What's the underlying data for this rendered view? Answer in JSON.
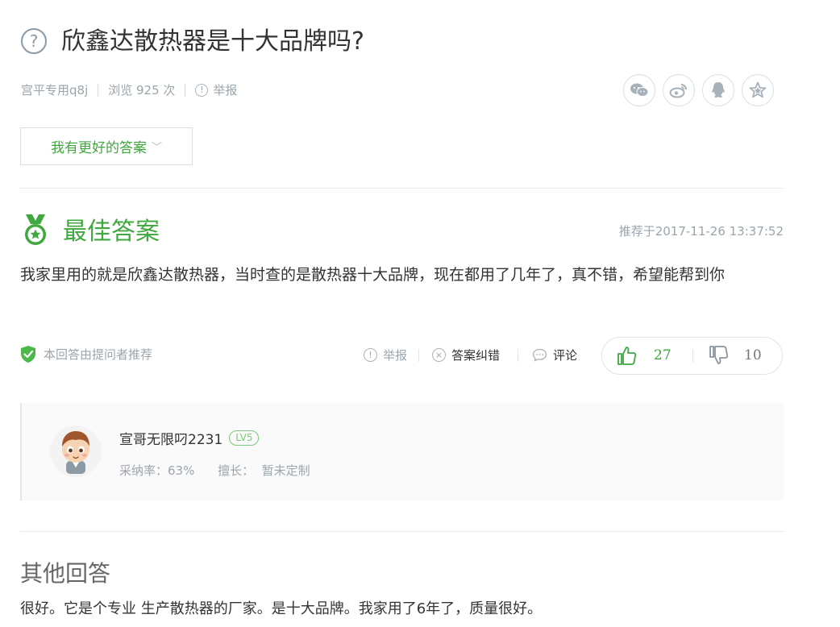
{
  "question": {
    "title": "欣鑫达散热器是十大品牌吗?",
    "asker": "宫平专用q8j",
    "views": "浏览 925 次",
    "report": "举报"
  },
  "share_icons": [
    "wechat-icon",
    "weibo-icon",
    "qq-icon",
    "star-icon"
  ],
  "better_answer_button": "我有更好的答案",
  "best_answer": {
    "heading": "最佳答案",
    "recommended_time": "推荐于2017-11-26 13:37:52",
    "text": "我家里用的就是欣鑫达散热器，当时查的是散热器十大品牌，现在都用了几年了，真不错，希望能帮到你",
    "asker_recommended": "本回答由提问者推荐",
    "actions": {
      "report": "举报",
      "correct": "答案纠错",
      "comment": "评论"
    },
    "likes": "27",
    "dislikes": "10"
  },
  "answerer": {
    "name": "宣哥无限叼2231",
    "level": "LV5",
    "adoption_rate": "采纳率：63%",
    "specialty": "擅长：  暂未定制"
  },
  "other_answers": {
    "heading": "其他回答",
    "items": [
      "很好。它是个专业 生产散热器的厂家。是十大品牌。我家用了6年了，质量很好。"
    ]
  },
  "colors": {
    "accent_green": "#3fa83f",
    "muted_text": "#9aa5ad",
    "card_bg": "#fafafa"
  }
}
